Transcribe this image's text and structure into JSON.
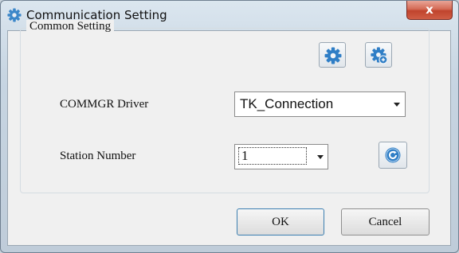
{
  "window": {
    "title": "Communication Setting",
    "close_glyph": "x",
    "title_icon": "gear-icon"
  },
  "group": {
    "label": "Common Setting",
    "tools": [
      "settings-gear-icon",
      "advanced-settings-gear-icon"
    ]
  },
  "fields": {
    "driver_label": "COMMGR Driver",
    "driver_value": "TK_Connection",
    "station_label": "Station Number",
    "station_value": "1",
    "refresh_icon": "refresh-icon"
  },
  "buttons": {
    "ok": "OK",
    "cancel": "Cancel"
  },
  "colors": {
    "icon_blue": "#2f7ec6",
    "close_red": "#c0442d"
  }
}
